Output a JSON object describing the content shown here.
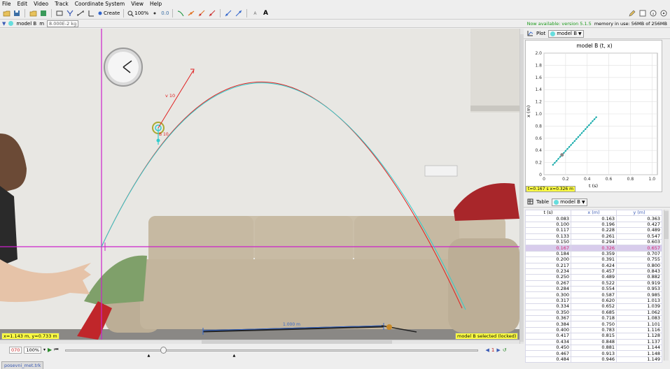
{
  "menu": [
    "File",
    "Edit",
    "Video",
    "Track",
    "Coordinate System",
    "View",
    "Help"
  ],
  "toolbar": {
    "create_label": "Create",
    "zoom_label": "100%",
    "plot_select_label": "0.0"
  },
  "trackbar": {
    "track_name": "model B",
    "mass_label": "m",
    "mass_value": "8.000E-2 kg",
    "version_notice": "Now available: version 5.1.5",
    "memory_notice": "memory in use: 56MB of 256MB"
  },
  "video": {
    "readout": "x=1.143 m, y=0.733 m",
    "selection_status": "model B selected (locked)",
    "calibration_label": "1.000 m",
    "vector_label": "v 10",
    "point_label": "B 10"
  },
  "player": {
    "frame": "070",
    "zoom": "100%",
    "step": "1"
  },
  "plot": {
    "tab_label": "Plot",
    "track": "model B",
    "title": "model B (t, x)",
    "xlabel": "t (s)",
    "ylabel": "x (m)",
    "readout": "t=0.167 s  x=0.326 m",
    "xticks": [
      "0",
      "0.2",
      "0.4",
      "0.6",
      "0.8",
      "1.0"
    ],
    "yticks": [
      "0",
      "0.2",
      "0.4",
      "0.6",
      "0.8",
      "1.0",
      "1.2",
      "1.4",
      "1.6",
      "1.8",
      "2.0"
    ]
  },
  "table": {
    "tab_label": "Table",
    "track": "model B",
    "headers": [
      "t (s)",
      "x (m)",
      "y (m)"
    ],
    "selected_index": 5,
    "rows": [
      [
        "0.083",
        "0.163",
        "0.363"
      ],
      [
        "0.100",
        "0.196",
        "0.427"
      ],
      [
        "0.117",
        "0.228",
        "0.489"
      ],
      [
        "0.133",
        "0.261",
        "0.547"
      ],
      [
        "0.150",
        "0.294",
        "0.603"
      ],
      [
        "0.167",
        "0.326",
        "0.657"
      ],
      [
        "0.184",
        "0.359",
        "0.707"
      ],
      [
        "0.200",
        "0.391",
        "0.755"
      ],
      [
        "0.217",
        "0.424",
        "0.800"
      ],
      [
        "0.234",
        "0.457",
        "0.843"
      ],
      [
        "0.250",
        "0.489",
        "0.882"
      ],
      [
        "0.267",
        "0.522",
        "0.919"
      ],
      [
        "0.284",
        "0.554",
        "0.953"
      ],
      [
        "0.300",
        "0.587",
        "0.985"
      ],
      [
        "0.317",
        "0.620",
        "1.013"
      ],
      [
        "0.334",
        "0.652",
        "1.039"
      ],
      [
        "0.350",
        "0.685",
        "1.062"
      ],
      [
        "0.367",
        "0.718",
        "1.083"
      ],
      [
        "0.384",
        "0.750",
        "1.101"
      ],
      [
        "0.400",
        "0.783",
        "1.116"
      ],
      [
        "0.417",
        "0.815",
        "1.128"
      ],
      [
        "0.434",
        "0.848",
        "1.137"
      ],
      [
        "0.450",
        "0.881",
        "1.144"
      ],
      [
        "0.467",
        "0.913",
        "1.148"
      ],
      [
        "0.484",
        "0.946",
        "1.149"
      ]
    ]
  },
  "file_tab": "posevni_met.trk",
  "colors": {
    "trajectory_red": "#e02020",
    "trajectory_cyan": "#33cccc",
    "axis_magenta": "#cc22cc",
    "highlight_yellow": "#ffff44"
  }
}
